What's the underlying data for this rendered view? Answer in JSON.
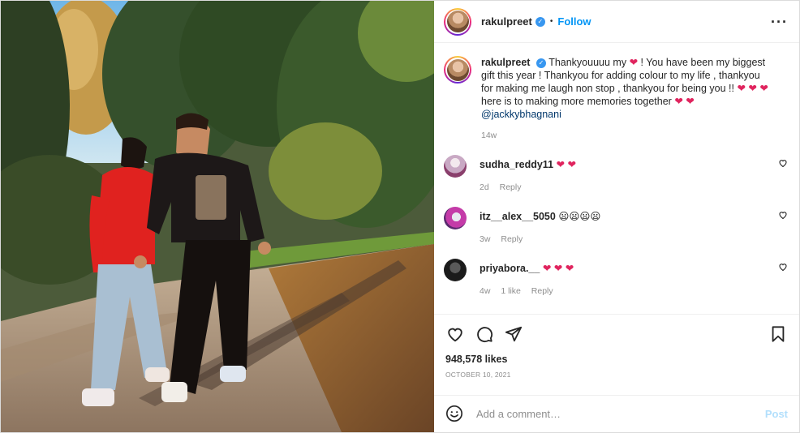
{
  "post": {
    "image_alt": "Couple walking on a tree-lined path",
    "author": {
      "username": "rakulpreet",
      "verified": true,
      "verified_icon": "verified-badge-icon",
      "dot": "•",
      "follow_label": "Follow",
      "more_icon": "more-options-icon",
      "more_label": "···"
    },
    "caption": {
      "username": "rakulpreet",
      "part1": "Thankyouuuu my",
      "part2": "! You have been my biggest gift this year ! Thankyou for adding colour to my life , thankyou for making me laugh non stop , thankyou for being you !!",
      "part3": "here is to making more memories together",
      "mention": "@jackkybhagnani",
      "heart": "❤",
      "hearts3": "❤ ❤ ❤",
      "hearts2": "❤ ❤",
      "time": "14w"
    },
    "comments": [
      {
        "username": "sudha_reddy11",
        "text": "❤ ❤",
        "time": "2d",
        "likes": "",
        "reply": "Reply",
        "avatar_color": "#d8c7d6"
      },
      {
        "username": "itz__alex__5050",
        "text": "😦😦😦😦",
        "time": "3w",
        "likes": "",
        "reply": "Reply",
        "avatar_color": "#c43ba8"
      },
      {
        "username": "priyabora.__",
        "text": "❤ ❤ ❤",
        "time": "4w",
        "likes": "1 like",
        "reply": "Reply",
        "avatar_color": "#2b2b2b"
      }
    ],
    "actions": {
      "like_icon": "heart-icon",
      "comment_icon": "comment-icon",
      "share_icon": "share-icon",
      "save_icon": "bookmark-icon"
    },
    "likes": "948,578 likes",
    "date": "OCTOBER 10, 2021",
    "add_comment": {
      "emoji_icon": "emoji-icon",
      "placeholder": "Add a comment…",
      "post_label": "Post"
    }
  },
  "colors": {
    "accent": "#0095f6",
    "heart": "#e0245e",
    "muted": "#8e8e8e",
    "post_disabled": "#b2dffc"
  }
}
